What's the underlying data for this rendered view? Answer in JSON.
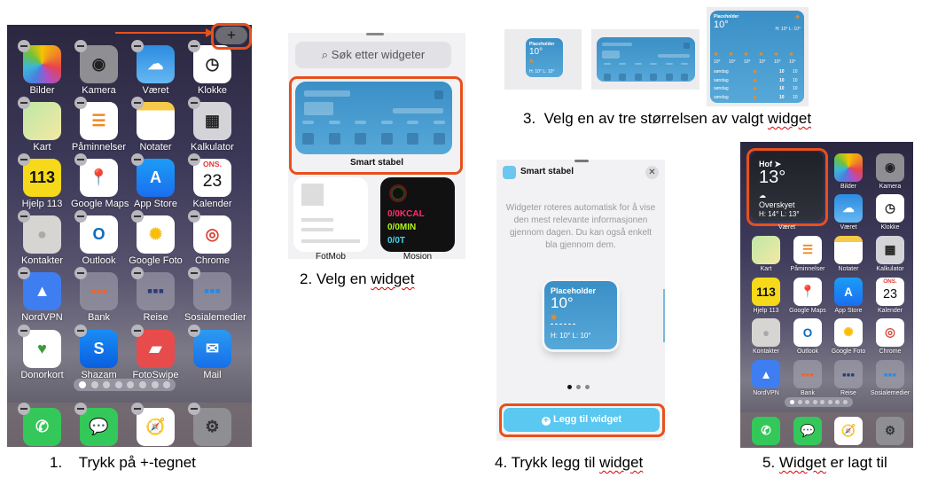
{
  "captions": {
    "step1": "1.    Trykk på +-tegnet",
    "step2_pre": "2. Velg en ",
    "step2_sq": "widget",
    "step3_pre": "3.  Velg en av tre størrelsen av valgt ",
    "step3_sq": "widget",
    "step4_pre": "4. Trykk legg til ",
    "step4_sq": "widget",
    "step5_pre": "5. ",
    "step5_sq": "Widget",
    "step5_post": " er lagt til"
  },
  "colors": {
    "highlight": "#e8501c",
    "widget_blue": "#3a8fc6",
    "add_button": "#5ac8f0"
  },
  "app_styles": {
    "Bilder": {
      "bg": "conic-gradient(#f5c400,#f08a24,#e8434c,#b04fc4,#4a7fe0,#3bb7d9,#6ac23f,#f5c400)",
      "text": "",
      "fg": "#fff"
    },
    "Kamera": {
      "bg": "#8e8e93",
      "text": "◉",
      "fg": "#222"
    },
    "Været": {
      "bg": "linear-gradient(#2c8be0,#66b8f2)",
      "text": "☁",
      "fg": "#fff"
    },
    "Klokke": {
      "bg": "#fff",
      "text": "◷",
      "fg": "#222"
    },
    "Kart": {
      "bg": "linear-gradient(135deg,#bfe7a8,#f4e8a2)",
      "text": "",
      "fg": "#1a73e8"
    },
    "Påminnelser": {
      "bg": "#fff",
      "text": "☰",
      "fg": "#f08a24"
    },
    "Notater": {
      "bg": "linear-gradient(#f7c948 0 22%,#fff 22%)",
      "text": "",
      "fg": "#999"
    },
    "Kalkulator": {
      "bg": "#d4d4d8",
      "text": "▦",
      "fg": "#222"
    },
    "Hjelp 113": {
      "bg": "#f6d91a",
      "text": "113",
      "fg": "#111"
    },
    "Google Maps": {
      "bg": "#fff",
      "text": "📍",
      "fg": "#ea4335"
    },
    "App Store": {
      "bg": "linear-gradient(#1c9cf6,#1a6ff0)",
      "text": "A",
      "fg": "#fff"
    },
    "Kalender": {
      "bg": "#fff",
      "text": "23",
      "fg": "#111"
    },
    "Kontakter": {
      "bg": "#d7d5d2",
      "text": "●",
      "fg": "#aaa"
    },
    "Outlook": {
      "bg": "#fff",
      "text": "O",
      "fg": "#0f6cbd"
    },
    "Google Foto": {
      "bg": "#fff",
      "text": "✺",
      "fg": "#fbbc04"
    },
    "Chrome": {
      "bg": "#fff",
      "text": "◎",
      "fg": "#db4437"
    },
    "NordVPN": {
      "bg": "#3e7ef0",
      "text": "▲",
      "fg": "#fff"
    },
    "Bank": {
      "bg": "rgba(170,170,180,.55)",
      "text": "▪▪▪",
      "fg": "#f0642a"
    },
    "Reise": {
      "bg": "rgba(170,170,180,.55)",
      "text": "▪▪▪",
      "fg": "#2a3a7a"
    },
    "Sosialemedier": {
      "bg": "rgba(170,170,180,.55)",
      "text": "▪▪▪",
      "fg": "#1d8cf0"
    },
    "Donorkort": {
      "bg": "#fff",
      "text": "♥",
      "fg": "#3b9b3b"
    },
    "Shazam": {
      "bg": "linear-gradient(#1a8cf5,#0a5fe0)",
      "text": "S",
      "fg": "#fff"
    },
    "FotoSwipe": {
      "bg": "#e84b4b",
      "text": "▰",
      "fg": "#fff"
    },
    "Mail": {
      "bg": "linear-gradient(#2c9af2,#1670e8)",
      "text": "✉",
      "fg": "#fff"
    },
    "Telefon": {
      "bg": "#34c759",
      "text": "✆",
      "fg": "#fff"
    },
    "Meldinger": {
      "bg": "#34c759",
      "text": "💬",
      "fg": "#fff"
    },
    "Safari": {
      "bg": "#fff",
      "text": "🧭",
      "fg": "#1a7cf0"
    },
    "Innstillinger": {
      "bg": "#8e8e93",
      "text": "⚙",
      "fg": "#333"
    }
  },
  "phone1": {
    "add_button": "+",
    "apps": [
      "Bilder",
      "Kamera",
      "Været",
      "Klokke",
      "Kart",
      "Påminnelser",
      "Notater",
      "Kalkulator",
      "Hjelp 113",
      "Google Maps",
      "App Store",
      "Kalender",
      "Kontakter",
      "Outlook",
      "Google Foto",
      "Chrome",
      "NordVPN",
      "Bank",
      "Reise",
      "Sosialemedier",
      "Donorkort",
      "Shazam",
      "FotoSwipe",
      "Mail"
    ],
    "dock": [
      "Telefon",
      "Meldinger",
      "Safari",
      "Innstillinger"
    ],
    "calendar_day": "ONS.",
    "page_count": 8
  },
  "panel2": {
    "search_placeholder": "Søk etter widgeter",
    "smart_stack_label": "Smart stabel",
    "fotmob_label": "FotMob",
    "activity_label": "Mosjon",
    "activity": {
      "kcal": "0/0KCAL",
      "min": "0/0MIN",
      "hours": "0/0T"
    }
  },
  "panel3": {
    "small": {
      "place": "Placeholder",
      "temp": "10°",
      "hl": "H: 10° L: 10°"
    },
    "large": {
      "place": "Placeholder",
      "temp": "10°",
      "hl": "H: 10° L: 10°",
      "hourly": [
        "10°",
        "10°",
        "10°",
        "10°",
        "10°",
        "10°"
      ],
      "daily": [
        {
          "day": "søndag",
          "high": "10",
          "low": "10"
        },
        {
          "day": "søndag",
          "high": "10",
          "low": "10"
        },
        {
          "day": "søndag",
          "high": "10",
          "low": "10"
        },
        {
          "day": "søndag",
          "high": "10",
          "low": "10"
        }
      ]
    }
  },
  "panel4": {
    "title": "Smart stabel",
    "description": "Widgeter roteres automatisk for å vise den mest relevante informasjonen gjennom dagen. Du kan også enkelt bla gjennom dem.",
    "widget": {
      "place": "Placeholder",
      "temp": "10°",
      "hl": "H: 10° L: 10°"
    },
    "add_button": "Legg til widget",
    "page_count": 3
  },
  "phone5": {
    "widget": {
      "place": "Hof",
      "temp": "13°",
      "condition": "Overskyet",
      "hl": "H: 14° L: 13°",
      "label": "Været"
    },
    "apps_top": [
      "Bilder",
      "Kamera",
      "Været",
      "Klokke"
    ],
    "apps": [
      "Kart",
      "Påminnelser",
      "Notater",
      "Kalkulator",
      "Hjelp 113",
      "Google Maps",
      "App Store",
      "Kalender",
      "Kontakter",
      "Outlook",
      "Google Foto",
      "Chrome",
      "NordVPN",
      "Bank",
      "Reise",
      "Sosialemedier"
    ],
    "dock": [
      "Telefon",
      "Meldinger",
      "Safari",
      "Innstillinger"
    ],
    "calendar_day": "ONS.",
    "page_count": 8
  }
}
